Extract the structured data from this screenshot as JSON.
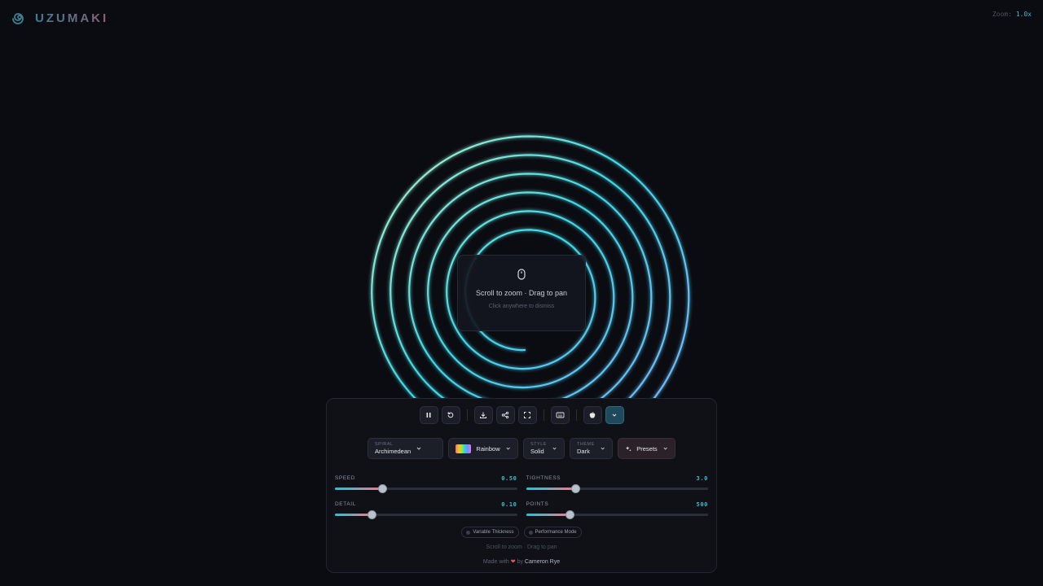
{
  "app": {
    "name": "UZUMAKI"
  },
  "zoom": {
    "label": "Zoom:",
    "value": "1.0x"
  },
  "hint": {
    "title": "Scroll to zoom · Drag to pan",
    "subtitle": "Click anywhere to dismiss"
  },
  "toolbar": {
    "buttons": [
      "pause-icon",
      "reset-icon",
      "download-icon",
      "share-icon",
      "fullscreen-icon",
      "keyboard-icon",
      "apple-icon",
      "chevron-down-icon"
    ]
  },
  "selectors": {
    "spiral": {
      "label": "SPIRAL",
      "value": "Archimedean"
    },
    "palette": {
      "value": "Rainbow"
    },
    "style": {
      "label": "STYLE",
      "value": "Solid"
    },
    "theme": {
      "label": "THEME",
      "value": "Dark"
    },
    "presets": {
      "value": "Presets"
    }
  },
  "sliders": {
    "speed": {
      "label": "SPEED",
      "value": "0.50",
      "fraction": 0.26
    },
    "tightness": {
      "label": "TIGHTNESS",
      "value": "3.0",
      "fraction": 0.27
    },
    "detail": {
      "label": "DETAIL",
      "value": "0.10",
      "fraction": 0.2
    },
    "points": {
      "label": "POINTS",
      "value": "500",
      "fraction": 0.24
    }
  },
  "toggles": {
    "variable_thickness": "Variable Thickness",
    "performance_mode": "Performance Mode"
  },
  "footer": {
    "hint": "Scroll to zoom · Drag to pan",
    "made_with": "Made with",
    "by": "by",
    "author": "Cameron Rye"
  },
  "colors": {
    "accent": "#38bdd0",
    "spiral_start": "#a7f3c0",
    "spiral_mid": "#3dd6e8",
    "spiral_end": "#7fb0ff"
  }
}
